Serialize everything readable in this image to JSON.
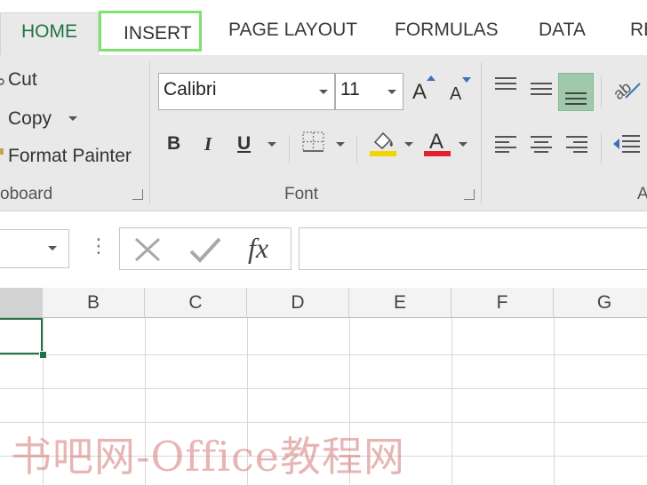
{
  "tabs": {
    "home": "HOME",
    "insert": "INSERT",
    "page_layout": "PAGE LAYOUT",
    "formulas": "FORMULAS",
    "data": "DATA",
    "review": "RE"
  },
  "clipboard": {
    "cut": "Cut",
    "copy": "Copy",
    "format_painter": "Format Painter",
    "group_label": "oboard"
  },
  "font": {
    "font_name": "Calibri",
    "font_size": "11",
    "bold": "B",
    "italic": "I",
    "underline": "U",
    "increase_size": "A",
    "decrease_size": "A",
    "font_color": "A",
    "group_label": "Font"
  },
  "alignment": {
    "group_label": "A"
  },
  "formula_bar": {
    "more_glyph": "⋮",
    "fx": "fx",
    "value": ""
  },
  "columns": [
    "B",
    "C",
    "D",
    "E",
    "F",
    "G"
  ],
  "watermark": "书吧网-Office教程网",
  "colors": {
    "excel_green": "#217346",
    "highlight_outline": "#7de36e",
    "fill_yellow": "#f2d600",
    "font_red": "#e2202e",
    "align_active": "#9fc9a9"
  }
}
